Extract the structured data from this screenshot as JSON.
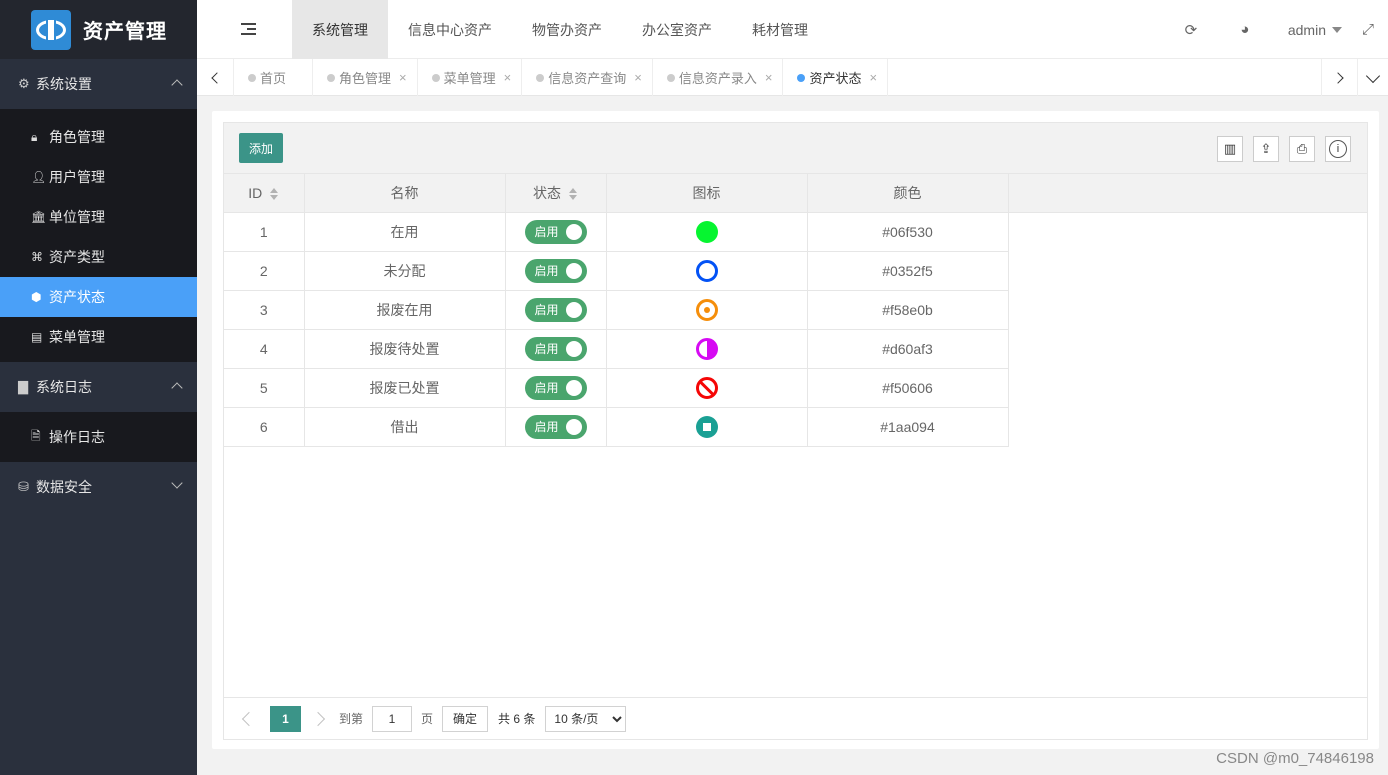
{
  "app": {
    "title": "资产管理"
  },
  "sidebar": {
    "groups": [
      {
        "label": "系统设置",
        "icon": "gears-icon",
        "expanded": true,
        "items": [
          {
            "label": "角色管理",
            "icon": "lock-icon"
          },
          {
            "label": "用户管理",
            "icon": "user-icon"
          },
          {
            "label": "单位管理",
            "icon": "institution-icon"
          },
          {
            "label": "资产类型",
            "icon": "asset-type-icon"
          },
          {
            "label": "资产状态",
            "icon": "cube-icon",
            "active": true
          },
          {
            "label": "菜单管理",
            "icon": "newspaper-icon"
          }
        ]
      },
      {
        "label": "系统日志",
        "icon": "file-icon",
        "expanded": true,
        "items": [
          {
            "label": "操作日志",
            "icon": "file-text-icon"
          }
        ]
      },
      {
        "label": "数据安全",
        "icon": "database-icon",
        "expanded": false,
        "items": []
      }
    ]
  },
  "header": {
    "top_tabs": [
      "系统管理",
      "信息中心资产",
      "物管办资产",
      "办公室资产",
      "耗材管理"
    ],
    "active_top_tab": 0,
    "user": "admin"
  },
  "page_tabs": [
    {
      "label": "首页",
      "closable": false
    },
    {
      "label": "角色管理",
      "closable": true
    },
    {
      "label": "菜单管理",
      "closable": true
    },
    {
      "label": "信息资产查询",
      "closable": true
    },
    {
      "label": "信息资产录入",
      "closable": true
    },
    {
      "label": "资产状态",
      "closable": true,
      "active": true
    }
  ],
  "toolbar": {
    "add_label": "添加"
  },
  "table": {
    "columns": [
      "ID",
      "名称",
      "状态",
      "图标",
      "颜色"
    ],
    "rows": [
      {
        "id": "1",
        "name": "在用",
        "status": "启用",
        "icon": "filled-circle-icon",
        "color": "#06f530"
      },
      {
        "id": "2",
        "name": "未分配",
        "status": "启用",
        "icon": "circle-outline-icon",
        "color": "#0352f5"
      },
      {
        "id": "3",
        "name": "报废在用",
        "status": "启用",
        "icon": "dot-circle-icon",
        "color": "#f58e0b"
      },
      {
        "id": "4",
        "name": "报废待处置",
        "status": "启用",
        "icon": "half-circle-icon",
        "color": "#d60af3"
      },
      {
        "id": "5",
        "name": "报废已处置",
        "status": "启用",
        "icon": "ban-icon",
        "color": "#f50606"
      },
      {
        "id": "6",
        "name": "借出",
        "status": "启用",
        "icon": "stop-circle-icon",
        "color": "#1aa094"
      }
    ]
  },
  "pagination": {
    "current": "1",
    "goto_label": "到第",
    "page_input": "1",
    "page_unit": "页",
    "confirm": "确定",
    "total": "共 6 条",
    "page_size": "10 条/页"
  },
  "watermark": "CSDN @m0_74846198"
}
